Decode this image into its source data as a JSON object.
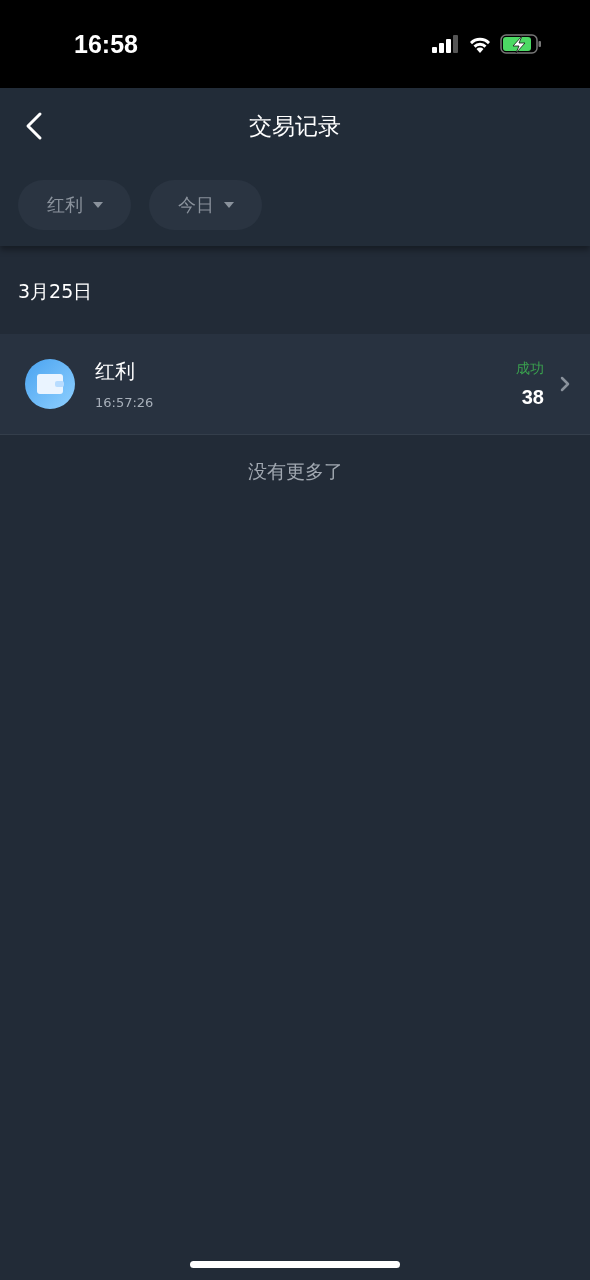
{
  "status_bar": {
    "time": "16:58"
  },
  "header": {
    "title": "交易记录"
  },
  "filters": [
    {
      "label": "红利"
    },
    {
      "label": "今日"
    }
  ],
  "groups": [
    {
      "date": "3月25日",
      "records": [
        {
          "name": "红利",
          "time": "16:57:26",
          "status": {
            "text": "成功",
            "kind": "success"
          },
          "amount": "38"
        }
      ]
    }
  ],
  "footer": {
    "text": "没有更多了"
  }
}
